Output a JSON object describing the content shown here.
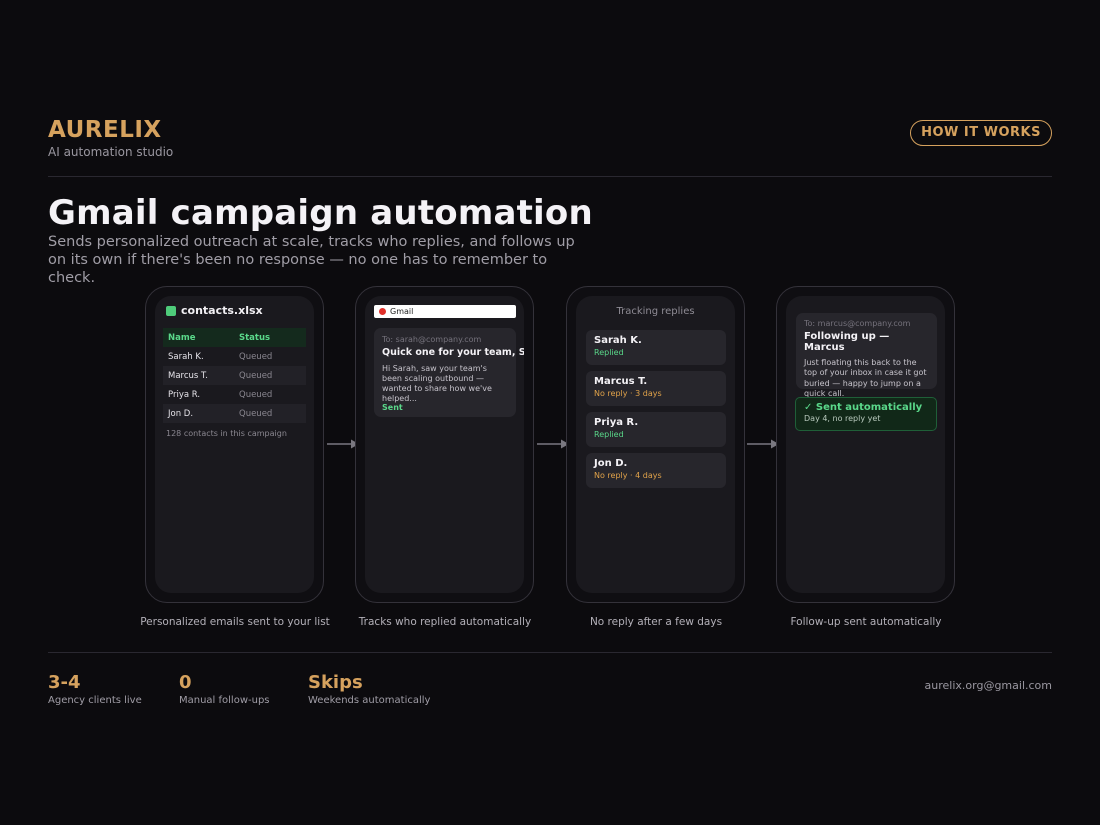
{
  "brand": {
    "name": "AURELIX",
    "tagline": "AI automation studio"
  },
  "header": {
    "cta_label": "HOW IT WORKS"
  },
  "hero": {
    "title": "Gmail campaign automation",
    "subtitle": "Sends personalized outreach at scale, tracks who replies, and follows up on its own if there's been no response — no one has to remember to check."
  },
  "steps": [
    {
      "caption": "Personalized emails sent to your list",
      "file_name": "contacts.xlsx",
      "columns": [
        "Name",
        "Status"
      ],
      "rows": [
        {
          "name": "Sarah K.",
          "status": "Queued"
        },
        {
          "name": "Marcus T.",
          "status": "Queued"
        },
        {
          "name": "Priya R.",
          "status": "Queued"
        },
        {
          "name": "Jon D.",
          "status": "Queued"
        }
      ],
      "footer": "128 contacts in this campaign"
    },
    {
      "caption": "Tracks who replied automatically",
      "app_label": "Gmail",
      "to": "To: sarah@company.com",
      "subject": "Quick one for your team, Sarah",
      "body": "Hi Sarah, saw your team's been scaling outbound — wanted to share how we've helped...",
      "status": "Sent"
    },
    {
      "caption": "No reply after a few days",
      "title": "Tracking replies",
      "contacts": [
        {
          "name": "Sarah K.",
          "status": "Replied",
          "color": "#5ad88a"
        },
        {
          "name": "Marcus T.",
          "status": "No reply · 3 days",
          "color": "#e0a24a"
        },
        {
          "name": "Priya R.",
          "status": "Replied",
          "color": "#5ad88a"
        },
        {
          "name": "Jon D.",
          "status": "No reply · 4 days",
          "color": "#e0a24a"
        }
      ]
    },
    {
      "caption": "Follow-up sent automatically",
      "to": "To: marcus@company.com",
      "subject": "Following up — Marcus",
      "body": "Just floating this back to the top of your inbox in case it got buried — happy to jump on a quick call.",
      "auto_title": "✓ Sent automatically",
      "auto_sub": "Day 4, no reply yet"
    }
  ],
  "stats": [
    {
      "value": "3-4",
      "label": "Agency clients live"
    },
    {
      "value": "0",
      "label": "Manual follow-ups"
    },
    {
      "value": "Skips",
      "label": "Weekends automatically"
    }
  ],
  "contact_email": "aurelix.org@gmail.com",
  "colors": {
    "accent": "#d6a25e",
    "success": "#5ad88a",
    "warning": "#e0a24a",
    "background": "#0c0b0e"
  }
}
